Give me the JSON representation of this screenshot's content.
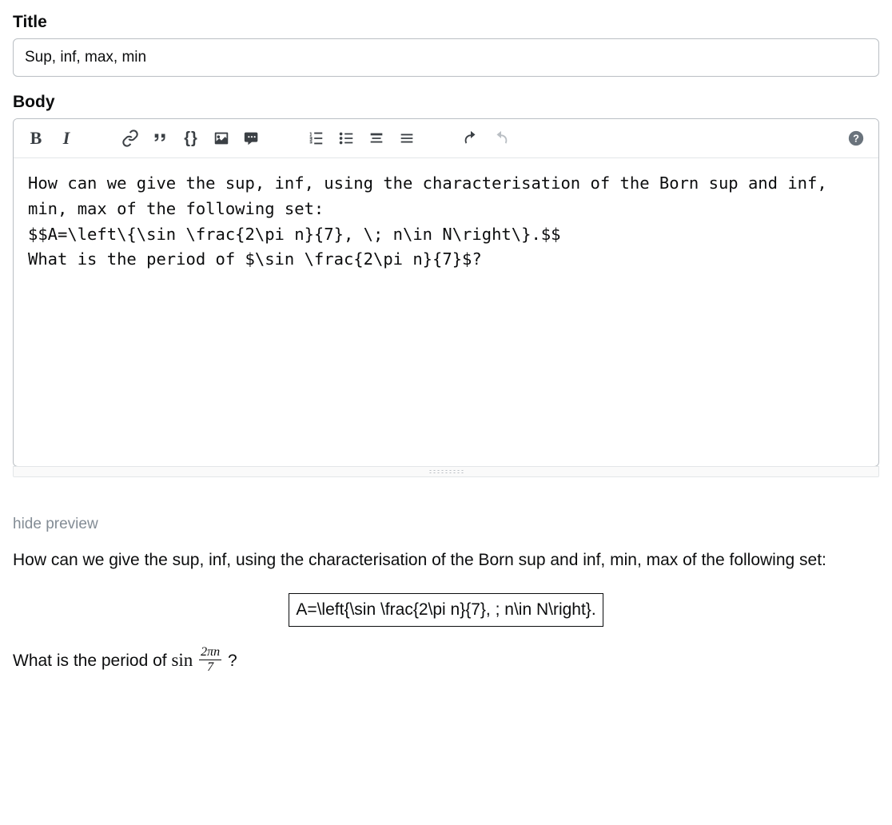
{
  "title": {
    "label": "Title",
    "value": "Sup, inf, max, min"
  },
  "body": {
    "label": "Body",
    "content": "How can we give the sup, inf, using the characterisation of the Born sup and inf, min, max of the following set:\n$$A=\\left\\{\\sin \\frac{2\\pi n}{7}, \\; n\\in N\\right\\}.$$\nWhat is the period of $\\sin \\frac{2\\pi n}{7}$?"
  },
  "toolbar": {
    "bold": "B",
    "italic": "I",
    "code": "{}"
  },
  "hide_preview": "hide preview",
  "preview": {
    "para1": "How can we give the sup, inf, using the characterisation of the Born sup and inf, min, max of the following set:",
    "formula_display": "A=\\left{\\sin \\frac{2\\pi n}{7}, ; n\\in N\\right}.",
    "para2_prefix": "What is the period of ",
    "para2_sin": "sin",
    "para2_frac_num": "2πn",
    "para2_frac_den": "7",
    "para2_suffix": " ?"
  }
}
